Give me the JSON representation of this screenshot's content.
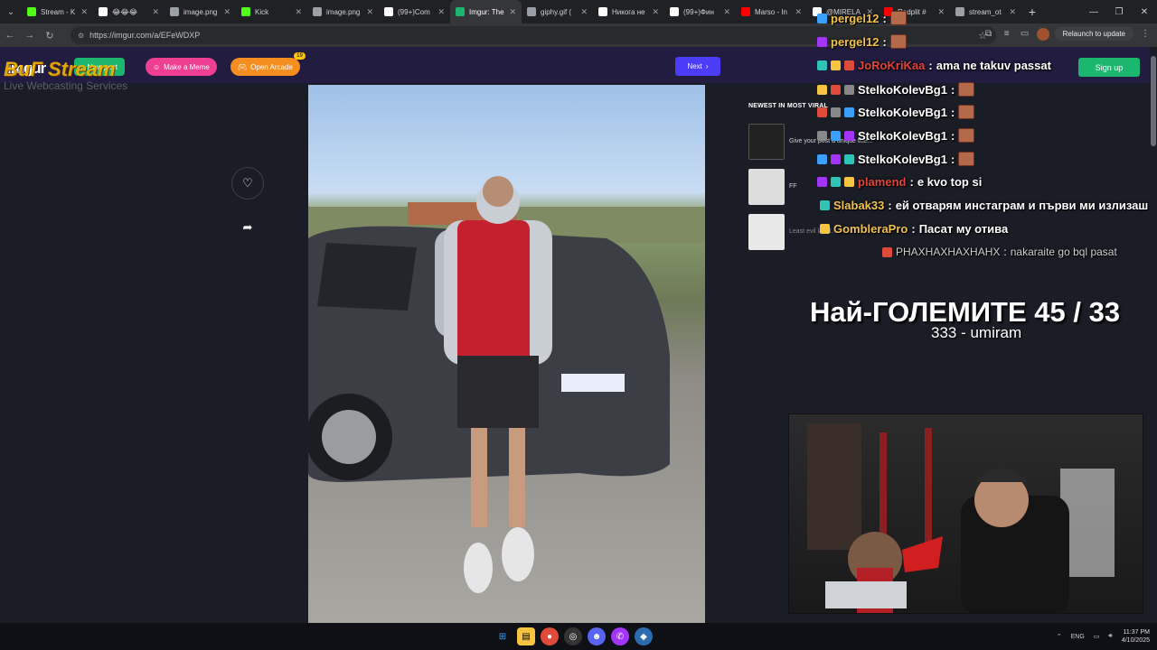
{
  "browser": {
    "tabs": [
      {
        "label": "Stream - K",
        "icon": "kick-icon",
        "color": "#53fc18",
        "active": false
      },
      {
        "label": "😂😂😂",
        "icon": "tiktok-icon",
        "color": "#ffffff",
        "active": false
      },
      {
        "label": "image.png",
        "icon": "globe-icon",
        "color": "#9aa0a6",
        "active": false
      },
      {
        "label": "Kick",
        "icon": "kick-icon",
        "color": "#53fc18",
        "active": false
      },
      {
        "label": "image.png",
        "icon": "globe-icon",
        "color": "#9aa0a6",
        "active": false
      },
      {
        "label": "(99+)Com",
        "icon": "tiktok-icon",
        "color": "#ffffff",
        "active": false
      },
      {
        "label": "Imgur: The",
        "icon": "imgur-icon",
        "color": "#1bb76e",
        "active": true
      },
      {
        "label": "giphy.gif (",
        "icon": "globe-icon",
        "color": "#9aa0a6",
        "active": false
      },
      {
        "label": "Никога не",
        "icon": "tiktok-icon",
        "color": "#ffffff",
        "active": false
      },
      {
        "label": "(99+)Фин",
        "icon": "tiktok-icon",
        "color": "#ffffff",
        "active": false
      },
      {
        "label": "Marso - In",
        "icon": "youtube-icon",
        "color": "#ff0000",
        "active": false
      },
      {
        "label": "@MIRELA",
        "icon": "tiktok-icon",
        "color": "#ffffff",
        "active": false
      },
      {
        "label": "Redplit #",
        "icon": "youtube-icon",
        "color": "#ff0000",
        "active": false
      },
      {
        "label": "stream_ot",
        "icon": "globe-icon",
        "color": "#9aa0a6",
        "active": false
      }
    ],
    "url": "https://imgur.com/a/EFeWDXP",
    "relaunch_label": "Relaunch to update"
  },
  "imgur": {
    "logo": "imgur",
    "new_post": "New post",
    "make_meme": "Make a Meme",
    "open_arcade": "Open Arcade",
    "arcade_badge": "19",
    "next": "Next",
    "sign_up": "Sign up",
    "sidebar_title": "NEWEST IN MOST VIRAL",
    "posts": [
      {
        "title": "Give your post a unique title..."
      },
      {
        "title": "FF"
      },
      {
        "title": "Least evil label..."
      }
    ]
  },
  "watermark": {
    "brand": "BuГ Stream",
    "subtitle": "Live Webcasting Services"
  },
  "chat": [
    {
      "user": "pergel12",
      "user_color": "#f2c14e",
      "message": "",
      "emote": true
    },
    {
      "user": "pergel12",
      "user_color": "#f2c14e",
      "message": "",
      "emote": true
    },
    {
      "user": "JoRoKriKaa",
      "user_color": "#e0443a",
      "message": "ama ne takuv passat",
      "emote": false
    },
    {
      "user": "StelkoKolevBg1",
      "user_color": "#ffffff",
      "message": "",
      "emote": true
    },
    {
      "user": "StelkoKolevBg1",
      "user_color": "#ffffff",
      "message": "",
      "emote": true
    },
    {
      "user": "StelkoKolevBg1",
      "user_color": "#ffffff",
      "message": "",
      "emote": true
    },
    {
      "user": "StelkoKolevBg1",
      "user_color": "#ffffff",
      "message": "",
      "emote": true
    },
    {
      "user": "plamend",
      "user_color": "#e0443a",
      "message": "e kvo top si",
      "emote": false
    },
    {
      "user": "Slabak33",
      "user_color": "#f2c14e",
      "message": "ей отварям инстаграм и първи ми излизаш",
      "emote": false
    },
    {
      "user": "GombleraPro",
      "user_color": "#f2c14e",
      "message": "Пасат му отива",
      "emote": false
    },
    {
      "user": "РНАХНАХНАХНАНХ",
      "user_color": "#cfcfcf",
      "message": "nakaraite go bql pasat",
      "emote": false
    }
  ],
  "overlay": {
    "title": "Най-ГОЛЕМИТЕ 45 / 33",
    "subtitle": "333 - umiram"
  },
  "taskbar": {
    "lang": "ENG",
    "time": "11:37 PM",
    "date": "4/10/2025"
  }
}
